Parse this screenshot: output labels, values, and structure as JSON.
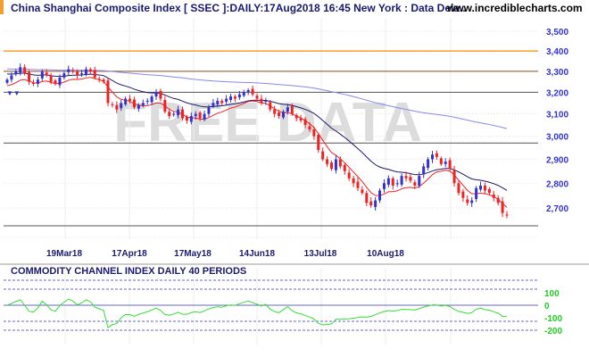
{
  "header": {
    "title": "China Shanghai Composite Index [ SSEC ]:DAILY:17Aug2018 16:45 New York : Data Dela..",
    "site": "www.incrediblecharts.com"
  },
  "watermark": "FREE DATA",
  "colors": {
    "up": "#3333cc",
    "down": "#ee2222",
    "ma_short": "#ee2222",
    "ma_mid": "#1a1a6e",
    "ma_long": "#8888ee",
    "resistance": "#ff8800",
    "cci": "#33dd33",
    "price_axis": "#3333cc",
    "cci_axis": "#22cc22"
  },
  "chart_data": [
    {
      "type": "candlestick",
      "title": "China Shanghai Composite Index [ SSEC ]:DAILY",
      "yticks": [
        3500,
        3400,
        3300,
        3200,
        3100,
        3000,
        2900,
        2800,
        2700
      ],
      "ytick_labels": [
        "3,500",
        "3,400",
        "3,300",
        "3,200",
        "3,100",
        "3,000",
        "2,900",
        "2,800",
        "2,700"
      ],
      "xtick_labels": [
        "19Mar18",
        "17Apr18",
        "17May18",
        "14Jun18",
        "13Jul18",
        "10Aug18"
      ],
      "ylim": [
        2600,
        3600
      ],
      "horizontal_lines": {
        "orange": [
          3400,
          3300
        ],
        "dark": [
          3200,
          2970,
          2630
        ]
      },
      "closes": [
        3260,
        3280,
        3300,
        3320,
        3290,
        3250,
        3240,
        3260,
        3300,
        3280,
        3250,
        3240,
        3270,
        3290,
        3310,
        3300,
        3280,
        3290,
        3310,
        3300,
        3270,
        3260,
        3250,
        3150,
        3140,
        3120,
        3150,
        3170,
        3160,
        3130,
        3140,
        3150,
        3160,
        3180,
        3200,
        3170,
        3110,
        3090,
        3100,
        3120,
        3080,
        3070,
        3090,
        3100,
        3080,
        3100,
        3130,
        3150,
        3160,
        3150,
        3170,
        3180,
        3170,
        3190,
        3200,
        3210,
        3190,
        3170,
        3150,
        3160,
        3120,
        3100,
        3090,
        3110,
        3130,
        3100,
        3080,
        3070,
        3050,
        3030,
        3000,
        2940,
        2900,
        2880,
        2860,
        2900,
        2870,
        2850,
        2820,
        2800,
        2780,
        2760,
        2720,
        2710,
        2730,
        2770,
        2800,
        2820,
        2790,
        2800,
        2830,
        2820,
        2810,
        2790,
        2830,
        2870,
        2900,
        2920,
        2910,
        2880,
        2890,
        2860,
        2800,
        2760,
        2740,
        2720,
        2730,
        2780,
        2790,
        2770,
        2760,
        2740,
        2720,
        2680,
        2670
      ]
    },
    {
      "type": "line",
      "title": "COMMODITY CHANNEL INDEX DAILY 40 PERIODS",
      "yticks": [
        100,
        0,
        -100,
        -200
      ],
      "ytick_labels": [
        "100",
        "0",
        "-100",
        "-200"
      ],
      "ylim": [
        -300,
        250
      ],
      "period": 40
    }
  ]
}
